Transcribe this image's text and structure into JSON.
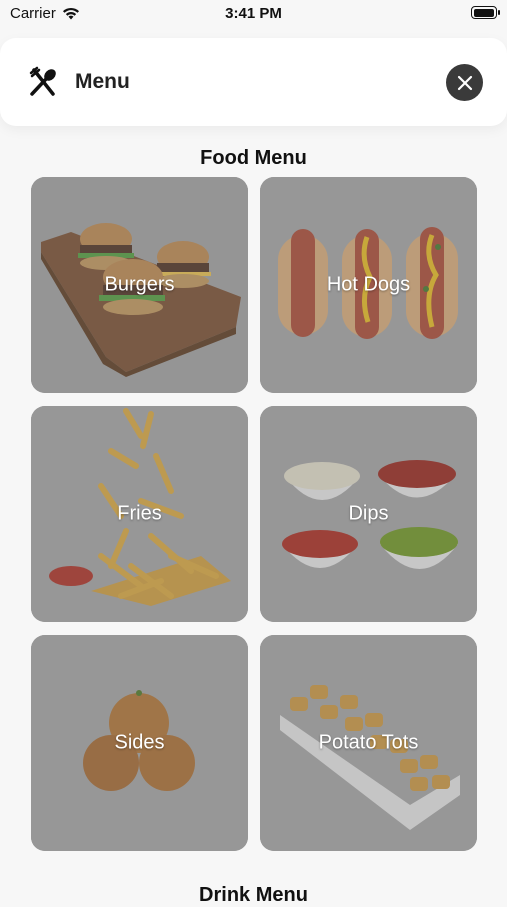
{
  "status_bar": {
    "carrier": "Carrier",
    "time": "3:41 PM",
    "battery_level": 0.9
  },
  "header": {
    "title": "Menu",
    "icon": "fork-spoon-icon",
    "close_icon": "close-icon"
  },
  "food_section": {
    "title": "Food Menu",
    "items": [
      {
        "label": "Burgers"
      },
      {
        "label": "Hot Dogs"
      },
      {
        "label": "Fries"
      },
      {
        "label": "Dips"
      },
      {
        "label": "Sides"
      },
      {
        "label": "Potato Tots"
      }
    ]
  },
  "drink_section": {
    "title": "Drink Menu"
  },
  "colors": {
    "tile_background": "#9a9a9a",
    "header_background": "#ffffff",
    "close_button": "#3a3a3a"
  }
}
